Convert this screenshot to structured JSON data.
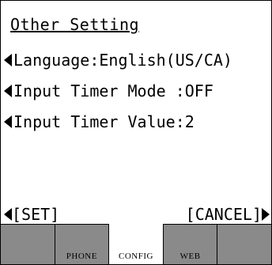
{
  "screen": {
    "title": "Other Setting"
  },
  "settings": [
    {
      "label": "Language:English(US/CA)"
    },
    {
      "label": "Input Timer Mode :OFF"
    },
    {
      "label": "Input Timer Value:2"
    }
  ],
  "softkeys": {
    "left": "[SET]",
    "right": "[CANCEL]"
  },
  "tabs": [
    {
      "label": ""
    },
    {
      "label": "PHONE"
    },
    {
      "label": "CONFIG",
      "active": true
    },
    {
      "label": "WEB"
    },
    {
      "label": ""
    }
  ],
  "icons": {
    "row_arrow": "left-arrow-icon",
    "softkey_left_arrow": "left-arrow-icon",
    "softkey_right_arrow": "right-arrow-icon"
  }
}
